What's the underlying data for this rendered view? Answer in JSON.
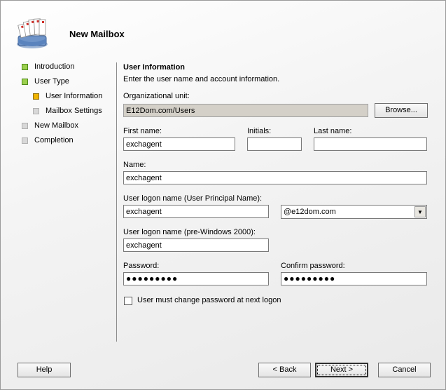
{
  "header": {
    "title": "New Mailbox",
    "icon": "mailbox-icon"
  },
  "nav": {
    "items": [
      {
        "label": "Introduction",
        "state": "done"
      },
      {
        "label": "User Type",
        "state": "done"
      },
      {
        "label": "User Information",
        "state": "current"
      },
      {
        "label": "Mailbox Settings",
        "state": "pending"
      },
      {
        "label": "New Mailbox",
        "state": "pending"
      },
      {
        "label": "Completion",
        "state": "pending"
      }
    ]
  },
  "form": {
    "section_title": "User Information",
    "section_desc": "Enter the user name and account information.",
    "org_unit_label": "Organizational unit:",
    "org_unit_value": "E12Dom.com/Users",
    "browse_label": "Browse...",
    "first_name_label": "First name:",
    "first_name_value": "exchagent",
    "initials_label": "Initials:",
    "initials_value": "",
    "last_name_label": "Last name:",
    "last_name_value": "",
    "name_label": "Name:",
    "name_value": "exchagent",
    "upn_label": "User logon name (User Principal Name):",
    "upn_value": "exchagent",
    "domain_value": "@e12dom.com",
    "pre2000_label": "User logon name (pre-Windows 2000):",
    "pre2000_value": "exchagent",
    "password_label": "Password:",
    "password_value": "●●●●●●●●●",
    "confirm_label": "Confirm password:",
    "confirm_value": "●●●●●●●●●",
    "must_change_label": "User must change password at next logon",
    "must_change_checked": false
  },
  "buttons": {
    "help": "Help",
    "back": "< Back",
    "next": "Next >",
    "cancel": "Cancel"
  }
}
